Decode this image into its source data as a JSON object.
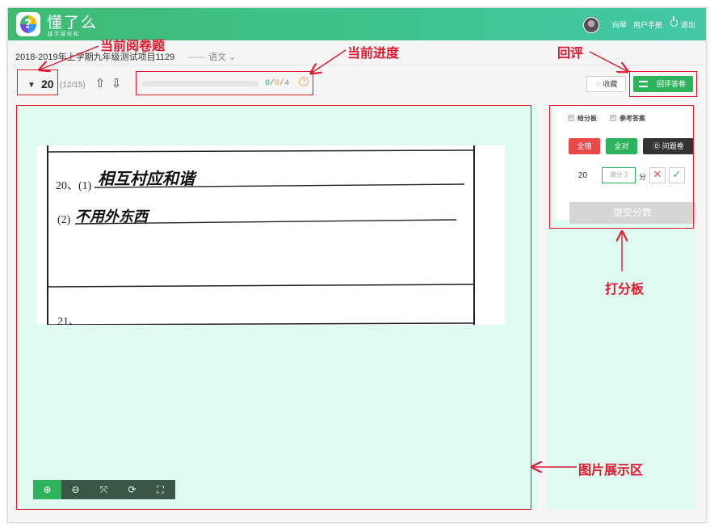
{
  "header": {
    "brand": "懂了么",
    "slogan": "越学越轻松",
    "user_name": "向琴",
    "manual": "用户手册",
    "logout": "退出"
  },
  "project": {
    "title": "2018-2019年上学期九年级测试项目1129",
    "subject": "语文",
    "subject_dash": "——"
  },
  "toolbar": {
    "question_number": "20",
    "question_count": "(12/15)",
    "progress_done": "0",
    "progress_bad": "0",
    "progress_total": "4",
    "progress_sep": "/",
    "progress_fraction": 0.0,
    "favorite": "收藏",
    "review": "回评答卷"
  },
  "score_panel": {
    "option_board": "给分板",
    "option_answer": "参考答案",
    "all_wrong": "全错",
    "all_right": "全对",
    "problem_paper": "问题卷",
    "question_no": "20",
    "score_placeholder": "满分 2",
    "unit": "分",
    "submit": "提交分数"
  },
  "paper": {
    "q20_label": "20、(1)",
    "q20_answer1": "相互村应和谐",
    "q20_sub2": "(2)",
    "q20_answer2": "不用外东西",
    "q21_label": "21、"
  },
  "annotations": {
    "current_question": "当前阅卷题",
    "current_progress": "当前进度",
    "review": "回评",
    "score_board": "打分板",
    "image_area": "图片展示区"
  },
  "colors": {
    "primary": "#2db35c",
    "danger": "#e84a4a",
    "annotation": "#e0182d",
    "canvas": "#dffaf0"
  },
  "icons": [
    "zoom-in-icon",
    "zoom-out-icon",
    "fit-icon",
    "rotate-icon",
    "fullscreen-icon"
  ]
}
